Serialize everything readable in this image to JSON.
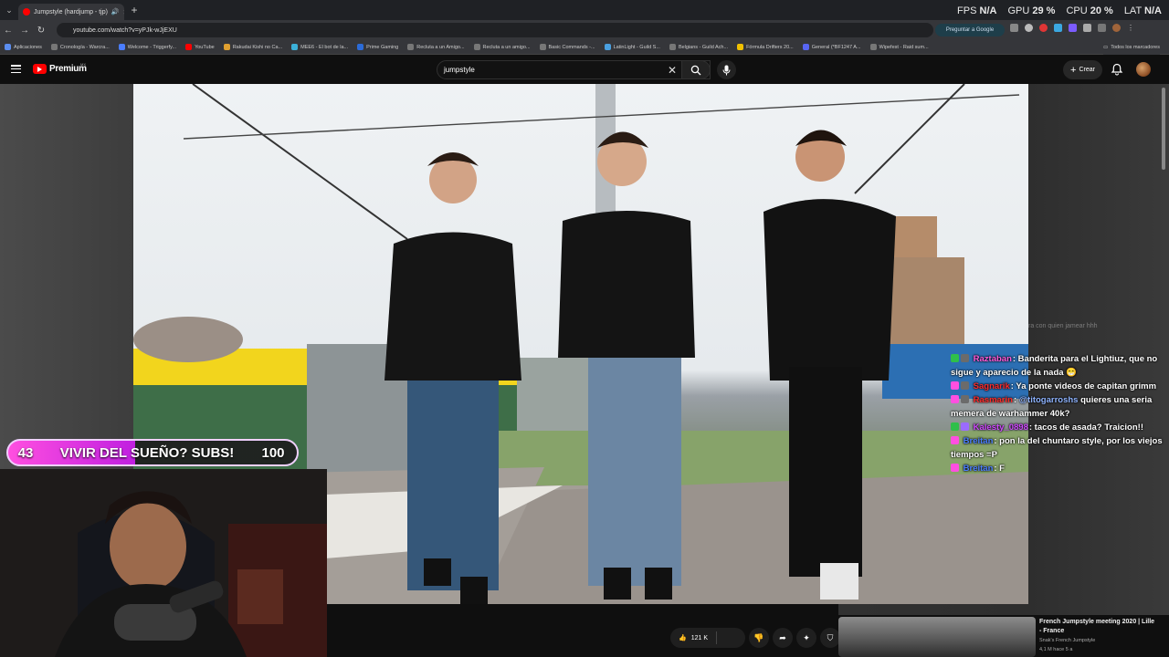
{
  "browser": {
    "tab_title": "Jumpstyle (hardjump - tjp)",
    "url": "youtube.com/watch?v=yPJk-wJjEXU",
    "ask_google": "Preguntar a Google",
    "all_bookmarks": "Todos los marcadores",
    "bookmarks": [
      "Aplicaciones",
      "Cronología - Warcra...",
      "Welcome - Triggerfy...",
      "YouTube",
      "Rakudai Kishi no Ca...",
      "MEE6 - El bot de la...",
      "Prime Gaming",
      "Recluta a un Amigo...",
      "Recluta a un amigo...",
      "Basic Commands -...",
      "LatinLight - Guild S...",
      "Belgians - Guild Ach...",
      "Fórmula Drifters 20...",
      "General (*BF1247 A...",
      "Wipefest - Raid sum..."
    ]
  },
  "overlay_stats": {
    "fps_label": "FPS",
    "fps_value": "N/A",
    "gpu_label": "GPU",
    "gpu_value": "29 %",
    "cpu_label": "CPU",
    "cpu_value": "20 %",
    "lat_label": "LAT",
    "lat_value": "N/A"
  },
  "youtube": {
    "logo_text": "Premium",
    "region": "MX",
    "search_value": "jumpstyle",
    "create_label": "Crear",
    "like_count": "121 K"
  },
  "recommendation": {
    "title": "French Jumpstyle meeting 2020 | Lille - France",
    "channel": "Snak's French Jumpstyle",
    "meta": "4,1 M  hace 5 a"
  },
  "sub_goal": {
    "current": "43",
    "text": "VIVIR DEL SUEÑO? SUBS!",
    "target": "100"
  },
  "chat": {
    "ghost": "ra con quien jamear hhh",
    "messages": [
      {
        "user": "Raztaban",
        "color": "#ff5ad9",
        "text": ": Banderita para el Lightiuz, que no sigue y aparecio de la nada 😁"
      },
      {
        "user": "Sagnarik",
        "color": "#ff2a2a",
        "text": ": Ya ponte videos de capitan grimm"
      },
      {
        "user": "Rasmarin",
        "color": "#ff2a2a",
        "text": ": "
      },
      {
        "user": "@titogarroshs",
        "color": "#8fb4ff",
        "text": " quieres una seria memera de warhammer 40k?"
      },
      {
        "user": "Kalesty_0898",
        "color": "#d04aff",
        "text": ": tacos de asada? Traicion!!"
      },
      {
        "user": "Breitan",
        "color": "#4a7dff",
        "text": ": pon la del chuntaro style, por los viejos tiempos =P"
      },
      {
        "user": "Breitan",
        "color": "#4a7dff",
        "text": ": F"
      }
    ]
  },
  "colors": {
    "accent_red": "#ff0000",
    "chat_badge_pink": "#ff4fe0",
    "chat_badge_green": "#2fbf4a"
  }
}
